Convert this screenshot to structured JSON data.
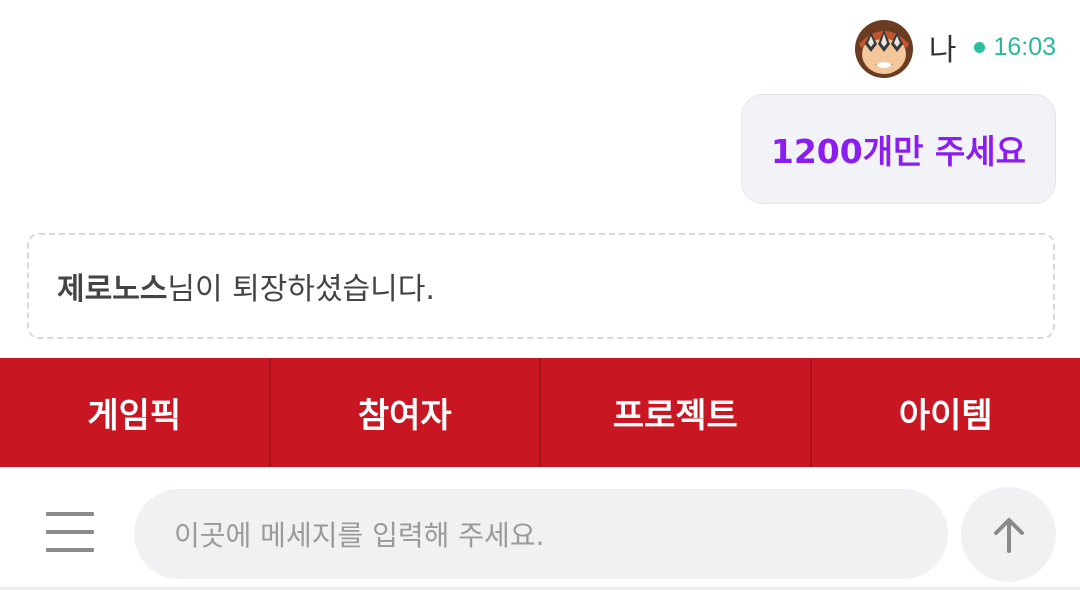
{
  "message": {
    "sender_name": "나",
    "timestamp": "16:03",
    "text": "1200개만 주세요"
  },
  "notice": {
    "user": "제로노스",
    "text": "님이 퇴장하셨습니다."
  },
  "tabs": [
    {
      "label": "게임픽"
    },
    {
      "label": "참여자"
    },
    {
      "label": "프로젝트"
    },
    {
      "label": "아이템"
    }
  ],
  "composer": {
    "placeholder": "이곳에 메세지를 입력해 주세요."
  },
  "icons": {
    "avatar": "masked-character-avatar",
    "menu": "hamburger-menu-icon",
    "send": "arrow-up-icon"
  },
  "colors": {
    "accent_red": "#c81623",
    "message_purple": "#8c1df0",
    "online_green": "#2bbf9c"
  }
}
